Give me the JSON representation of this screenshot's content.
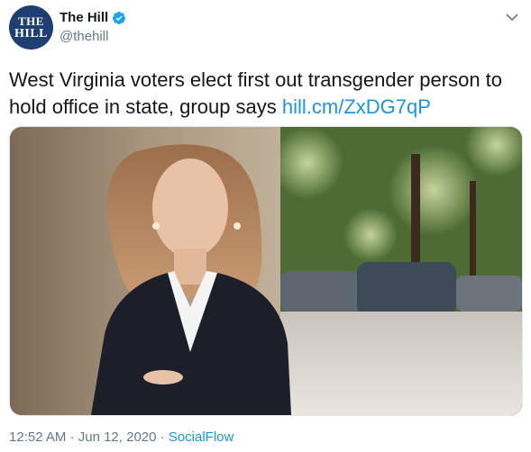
{
  "account": {
    "avatar_line1": "THE",
    "avatar_line2": "HILL",
    "name": "The Hill",
    "handle": "@thehill",
    "verified_icon": "verified-badge-icon"
  },
  "tweet": {
    "text": "West Virginia voters elect first out transgender person to hold office in state, group says",
    "link_text": "hill.cm/ZxDG7qP",
    "media_icon": "photo-of-woman-in-blazer"
  },
  "meta": {
    "time": "12:52 AM",
    "separator": "·",
    "date": "Jun 12, 2020",
    "source": "SocialFlow"
  },
  "colors": {
    "link": "#1b95e0",
    "secondary_text": "#657786",
    "primary_text": "#14171a",
    "avatar_bg": "#1f3f73"
  }
}
